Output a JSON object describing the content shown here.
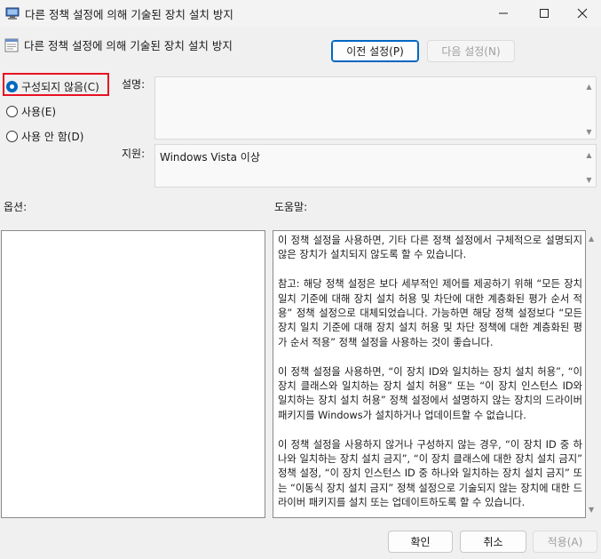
{
  "window": {
    "title": "다른 정책 설정에 의해 기술된 장치 설치 방지",
    "controls": {
      "minimize": "—",
      "maximize": "☐",
      "close": "✕"
    }
  },
  "header": {
    "policy_title": "다른 정책 설정에 의해 기술된 장치 설치 방지",
    "prev_button": "이전 설정(P)",
    "next_button": "다음 설정(N)"
  },
  "state": {
    "options": [
      {
        "label": "구성되지 않음(C)",
        "checked": true
      },
      {
        "label": "사용(E)",
        "checked": false
      },
      {
        "label": "사용 안 함(D)",
        "checked": false
      }
    ]
  },
  "comment": {
    "label": "설명:",
    "value": ""
  },
  "supported": {
    "label": "지원:",
    "value": "Windows Vista 이상"
  },
  "options_section": {
    "label": "옵션:"
  },
  "help_section": {
    "label": "도움말:",
    "paragraphs": [
      "이 정책 설정을 사용하면, 기타 다른 정책 설정에서 구체적으로 설명되지 않은 장치가 설치되지 않도록 할 수 있습니다.",
      "참고: 해당 정책 설정은 보다 세부적인 제어를 제공하기 위해 “모든 장치 일치 기준에 대해 장치 설치 허용 및 차단에 대한 계층화된 평가 순서 적용” 정책 설정으로 대체되었습니다. 가능하면 해당 정책 설정보다 “모든 장치 일치 기준에 대해 장치 설치 허용 및 차단 정책에 대한 계층화된 평가 순서 적용” 정책 설정을 사용하는 것이 좋습니다.",
      "이 정책 설정을 사용하면, “이 장치 ID와 일치하는 장치 설치 허용”, “이 장치 클래스와 일치하는 장치 설치 허용” 또는 “이 장치 인스턴스 ID와 일치하는 장치 설치 허용” 정책 설정에서 설명하지 않는 장치의 드라이버 패키지를 Windows가 설치하거나 업데이트할 수 없습니다.",
      "이 정책 설정을 사용하지 않거나 구성하지 않는 경우, “이 장치 ID 중 하나와 일치하는 장치 설치 금지”, “이 장치 클래스에 대한 장치 설치 금지” 정책 설정, “이 장치 인스턴스 ID 중 하나와 일치하는 장치 설치 금지” 또는 “이동식 장치 설치 금지” 정책 설정으로 기술되지 않는 장치에 대한 드라이버 패키지를 설치 또는 업데이트하도록 할 수 있습니다."
    ]
  },
  "footer": {
    "ok": "확인",
    "cancel": "취소",
    "apply": "적용(A)"
  },
  "colors": {
    "accent": "#0067c0",
    "focus_outline": "#e81123",
    "background": "#f0f0f0"
  }
}
